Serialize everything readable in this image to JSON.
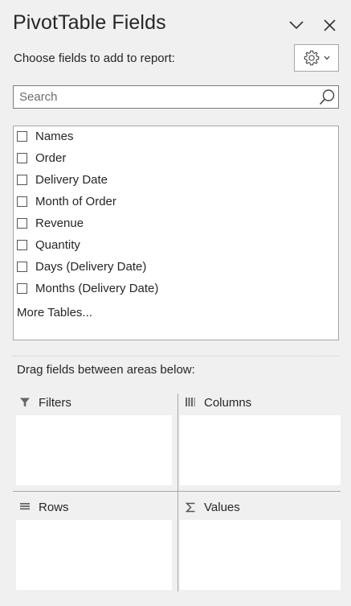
{
  "header": {
    "title": "PivotTable Fields",
    "choose_label": "Choose fields to add to report:"
  },
  "search": {
    "placeholder": "Search",
    "value": ""
  },
  "fields": [
    {
      "label": "Names",
      "checked": false
    },
    {
      "label": "Order",
      "checked": false
    },
    {
      "label": "Delivery Date",
      "checked": false
    },
    {
      "label": "Month of Order",
      "checked": false
    },
    {
      "label": "Revenue",
      "checked": false
    },
    {
      "label": "Quantity",
      "checked": false
    },
    {
      "label": "Days (Delivery Date)",
      "checked": false
    },
    {
      "label": "Months (Delivery Date)",
      "checked": false
    }
  ],
  "more_tables_label": "More Tables...",
  "areas": {
    "drag_label": "Drag fields between areas below:",
    "filters": {
      "label": "Filters",
      "icon": "filter-icon"
    },
    "columns": {
      "label": "Columns",
      "icon": "columns-icon"
    },
    "rows": {
      "label": "Rows",
      "icon": "rows-icon"
    },
    "values": {
      "label": "Values",
      "icon": "sigma-icon"
    }
  },
  "icons": {
    "collapse": "chevron-down-icon",
    "close": "close-icon",
    "settings": "gear-icon",
    "search": "search-icon"
  }
}
